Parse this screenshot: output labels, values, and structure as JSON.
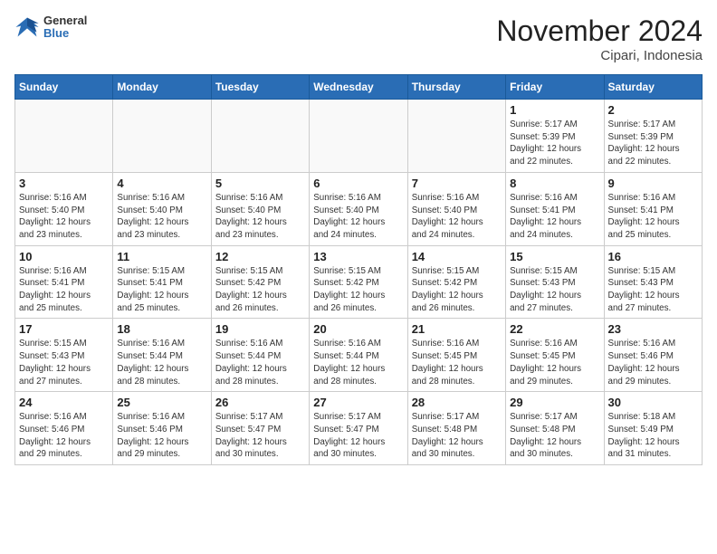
{
  "header": {
    "logo_general": "General",
    "logo_blue": "Blue",
    "title": "November 2024",
    "subtitle": "Cipari, Indonesia"
  },
  "calendar": {
    "days_of_week": [
      "Sunday",
      "Monday",
      "Tuesday",
      "Wednesday",
      "Thursday",
      "Friday",
      "Saturday"
    ],
    "weeks": [
      [
        {
          "day": "",
          "detail": ""
        },
        {
          "day": "",
          "detail": ""
        },
        {
          "day": "",
          "detail": ""
        },
        {
          "day": "",
          "detail": ""
        },
        {
          "day": "",
          "detail": ""
        },
        {
          "day": "1",
          "detail": "Sunrise: 5:17 AM\nSunset: 5:39 PM\nDaylight: 12 hours\nand 22 minutes."
        },
        {
          "day": "2",
          "detail": "Sunrise: 5:17 AM\nSunset: 5:39 PM\nDaylight: 12 hours\nand 22 minutes."
        }
      ],
      [
        {
          "day": "3",
          "detail": "Sunrise: 5:16 AM\nSunset: 5:40 PM\nDaylight: 12 hours\nand 23 minutes."
        },
        {
          "day": "4",
          "detail": "Sunrise: 5:16 AM\nSunset: 5:40 PM\nDaylight: 12 hours\nand 23 minutes."
        },
        {
          "day": "5",
          "detail": "Sunrise: 5:16 AM\nSunset: 5:40 PM\nDaylight: 12 hours\nand 23 minutes."
        },
        {
          "day": "6",
          "detail": "Sunrise: 5:16 AM\nSunset: 5:40 PM\nDaylight: 12 hours\nand 24 minutes."
        },
        {
          "day": "7",
          "detail": "Sunrise: 5:16 AM\nSunset: 5:40 PM\nDaylight: 12 hours\nand 24 minutes."
        },
        {
          "day": "8",
          "detail": "Sunrise: 5:16 AM\nSunset: 5:41 PM\nDaylight: 12 hours\nand 24 minutes."
        },
        {
          "day": "9",
          "detail": "Sunrise: 5:16 AM\nSunset: 5:41 PM\nDaylight: 12 hours\nand 25 minutes."
        }
      ],
      [
        {
          "day": "10",
          "detail": "Sunrise: 5:16 AM\nSunset: 5:41 PM\nDaylight: 12 hours\nand 25 minutes."
        },
        {
          "day": "11",
          "detail": "Sunrise: 5:15 AM\nSunset: 5:41 PM\nDaylight: 12 hours\nand 25 minutes."
        },
        {
          "day": "12",
          "detail": "Sunrise: 5:15 AM\nSunset: 5:42 PM\nDaylight: 12 hours\nand 26 minutes."
        },
        {
          "day": "13",
          "detail": "Sunrise: 5:15 AM\nSunset: 5:42 PM\nDaylight: 12 hours\nand 26 minutes."
        },
        {
          "day": "14",
          "detail": "Sunrise: 5:15 AM\nSunset: 5:42 PM\nDaylight: 12 hours\nand 26 minutes."
        },
        {
          "day": "15",
          "detail": "Sunrise: 5:15 AM\nSunset: 5:43 PM\nDaylight: 12 hours\nand 27 minutes."
        },
        {
          "day": "16",
          "detail": "Sunrise: 5:15 AM\nSunset: 5:43 PM\nDaylight: 12 hours\nand 27 minutes."
        }
      ],
      [
        {
          "day": "17",
          "detail": "Sunrise: 5:15 AM\nSunset: 5:43 PM\nDaylight: 12 hours\nand 27 minutes."
        },
        {
          "day": "18",
          "detail": "Sunrise: 5:16 AM\nSunset: 5:44 PM\nDaylight: 12 hours\nand 28 minutes."
        },
        {
          "day": "19",
          "detail": "Sunrise: 5:16 AM\nSunset: 5:44 PM\nDaylight: 12 hours\nand 28 minutes."
        },
        {
          "day": "20",
          "detail": "Sunrise: 5:16 AM\nSunset: 5:44 PM\nDaylight: 12 hours\nand 28 minutes."
        },
        {
          "day": "21",
          "detail": "Sunrise: 5:16 AM\nSunset: 5:45 PM\nDaylight: 12 hours\nand 28 minutes."
        },
        {
          "day": "22",
          "detail": "Sunrise: 5:16 AM\nSunset: 5:45 PM\nDaylight: 12 hours\nand 29 minutes."
        },
        {
          "day": "23",
          "detail": "Sunrise: 5:16 AM\nSunset: 5:46 PM\nDaylight: 12 hours\nand 29 minutes."
        }
      ],
      [
        {
          "day": "24",
          "detail": "Sunrise: 5:16 AM\nSunset: 5:46 PM\nDaylight: 12 hours\nand 29 minutes."
        },
        {
          "day": "25",
          "detail": "Sunrise: 5:16 AM\nSunset: 5:46 PM\nDaylight: 12 hours\nand 29 minutes."
        },
        {
          "day": "26",
          "detail": "Sunrise: 5:17 AM\nSunset: 5:47 PM\nDaylight: 12 hours\nand 30 minutes."
        },
        {
          "day": "27",
          "detail": "Sunrise: 5:17 AM\nSunset: 5:47 PM\nDaylight: 12 hours\nand 30 minutes."
        },
        {
          "day": "28",
          "detail": "Sunrise: 5:17 AM\nSunset: 5:48 PM\nDaylight: 12 hours\nand 30 minutes."
        },
        {
          "day": "29",
          "detail": "Sunrise: 5:17 AM\nSunset: 5:48 PM\nDaylight: 12 hours\nand 30 minutes."
        },
        {
          "day": "30",
          "detail": "Sunrise: 5:18 AM\nSunset: 5:49 PM\nDaylight: 12 hours\nand 31 minutes."
        }
      ]
    ]
  }
}
